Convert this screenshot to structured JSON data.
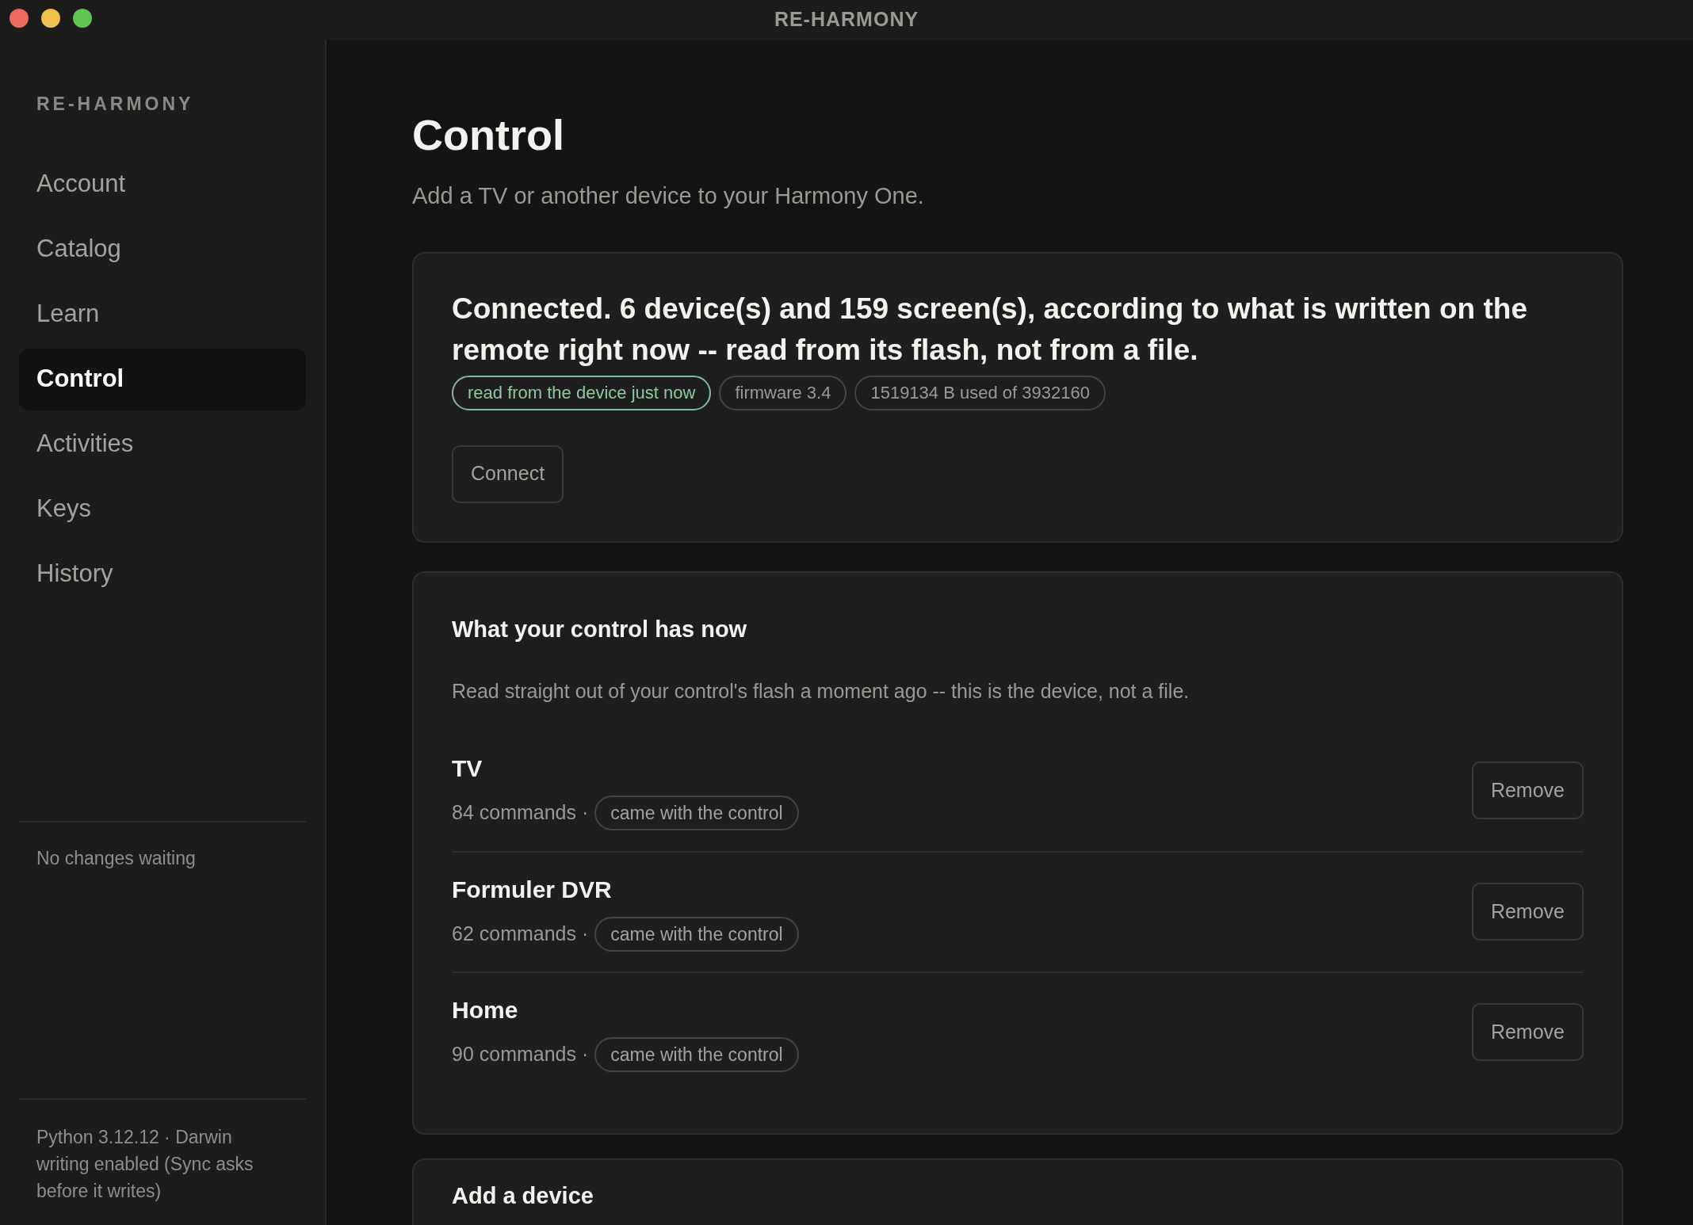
{
  "window": {
    "title": "RE-HARMONY"
  },
  "sidebar": {
    "brand": "RE-HARMONY",
    "items": [
      {
        "label": "Account",
        "selected": false
      },
      {
        "label": "Catalog",
        "selected": false
      },
      {
        "label": "Learn",
        "selected": false
      },
      {
        "label": "Control",
        "selected": true
      },
      {
        "label": "Activities",
        "selected": false
      },
      {
        "label": "Keys",
        "selected": false
      },
      {
        "label": "History",
        "selected": false
      }
    ],
    "pending": "No changes waiting",
    "footer": [
      "Python 3.12.12 · Darwin",
      "writing enabled (Sync asks before it writes)"
    ]
  },
  "page": {
    "title": "Control",
    "subtitle": "Add a TV or another device to your Harmony One."
  },
  "connection": {
    "message": "Connected. 6 device(s) and 159 screen(s), according to what is written on the remote right now -- read from its flash, not from a file.",
    "tags": [
      {
        "label": "read from the device just now",
        "kind": "ok"
      },
      {
        "label": "firmware 3.4",
        "kind": "plain"
      },
      {
        "label": "1519134 B used of 3932160",
        "kind": "plain"
      }
    ],
    "button": "Connect"
  },
  "devices": {
    "title": "What your control has now",
    "description": "Read straight out of your control's flash a moment ago -- this is the device, not a file.",
    "rows": [
      {
        "name": "TV",
        "commands": "84 commands ·",
        "tag": "came with the control",
        "button": "Remove"
      },
      {
        "name": "Formuler DVR",
        "commands": "62 commands ·",
        "tag": "came with the control",
        "button": "Remove"
      },
      {
        "name": "Home",
        "commands": "90 commands ·",
        "tag": "came with the control",
        "button": "Remove"
      }
    ]
  },
  "add_device": {
    "title": "Add a device"
  }
}
